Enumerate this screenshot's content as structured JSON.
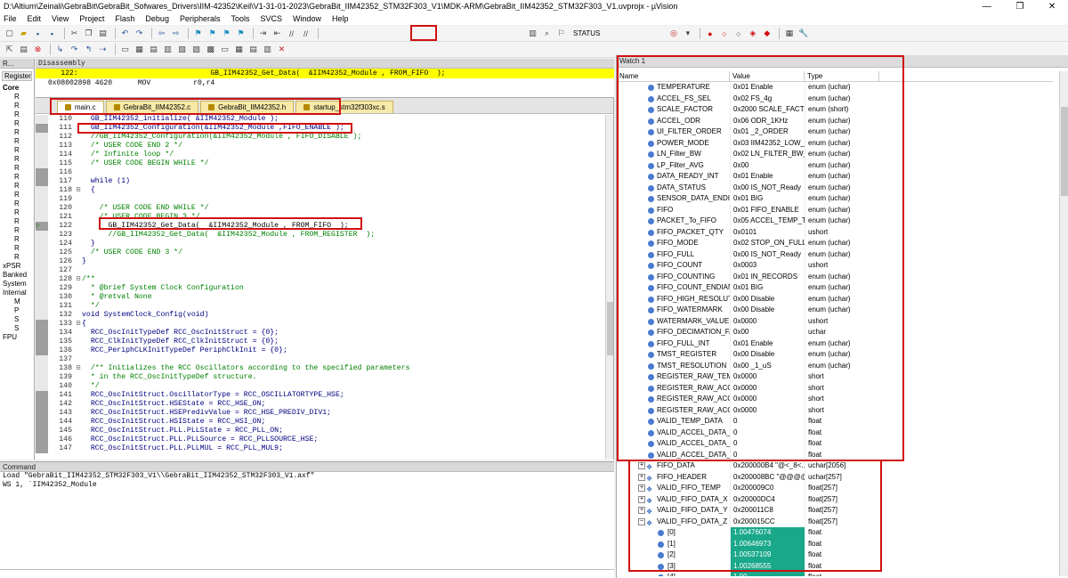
{
  "window": {
    "title": "D:\\Altium\\Zeinali\\GebraBit\\GebraBit_Sofwares_Drivers\\IIM-42352\\Keil\\V1-31-01-2023\\GebraBit_IIM42352_STM32F303_V1\\MDK-ARM\\GebraBit_IIM42352_STM32F303_V1.uvprojx - µVision"
  },
  "menu": [
    "File",
    "Edit",
    "View",
    "Project",
    "Flash",
    "Debug",
    "Peripherals",
    "Tools",
    "SVCS",
    "Window",
    "Help"
  ],
  "toolbar": {
    "target_label": "STATUS"
  },
  "left_pane": {
    "title": "R...",
    "tab": "Register",
    "tree": [
      "Core",
      "R",
      "R",
      "R",
      "R",
      "R",
      "R",
      "R",
      "R",
      "R",
      "R",
      "R",
      "R",
      "R",
      "R",
      "R",
      "R",
      "R",
      "R",
      "R",
      "xPSR",
      "Banked",
      "System",
      "Internal",
      "M",
      "P",
      "S",
      "S",
      "FPU"
    ]
  },
  "disassembly": {
    "title": "Disassembly",
    "line1": "   122:                               GB_IIM42352_Get_Data(  &IIM42352_Module , FROM_FIFO  );",
    "line2": "0x08002898 4620      MOV          r0,r4"
  },
  "editor": {
    "tabs": [
      "main.c",
      "GebraBit_IIM42352.c",
      "GebraBit_IIM42352.h",
      "startup_stm32f303xc.s"
    ],
    "lines": [
      {
        "n": "110",
        "t": "  GB_IIM42352_initialize( &IIM42352_Module );",
        "k": "code"
      },
      {
        "n": "111",
        "t": "  GB_IIM42352_Configuration(&IIM42352_Module ,FIFO_ENABLE );",
        "k": "code",
        "m": true
      },
      {
        "n": "112",
        "t": "  //GB_IIM42352_Configuration(&IIM42352_Module , FIFO_DISABLE );",
        "k": "cmt"
      },
      {
        "n": "113",
        "t": "  /* USER CODE END 2 */",
        "k": "cmt"
      },
      {
        "n": "114",
        "t": "  /* Infinite loop */",
        "k": "cmt"
      },
      {
        "n": "115",
        "t": "  /* USER CODE BEGIN WHILE */",
        "k": "cmt"
      },
      {
        "n": "116",
        "t": "",
        "k": "code",
        "m": true
      },
      {
        "n": "117",
        "t": "  while (1)",
        "k": "code",
        "m": true
      },
      {
        "n": "118",
        "t": "  {",
        "k": "code",
        "f": "⊟"
      },
      {
        "n": "119",
        "t": "",
        "k": "code"
      },
      {
        "n": "120",
        "t": "    /* USER CODE END WHILE */",
        "k": "cmt"
      },
      {
        "n": "121",
        "t": "    /* USER CODE BEGIN 3 */",
        "k": "cmt"
      },
      {
        "n": "122",
        "t": "      GB_IIM42352_Get_Data(  &IIM42352_Module , FROM_FIFO  );",
        "k": "cur",
        "m": true
      },
      {
        "n": "123",
        "t": "      //GB_IIM42352_Get_Data(  &IIM42352_Module , FROM_REGISTER  );",
        "k": "cmt"
      },
      {
        "n": "124",
        "t": "  }",
        "k": "code"
      },
      {
        "n": "125",
        "t": "  /* USER CODE END 3 */",
        "k": "cmt"
      },
      {
        "n": "126",
        "t": "}",
        "k": "code"
      },
      {
        "n": "127",
        "t": "",
        "k": "code"
      },
      {
        "n": "128",
        "t": "/**",
        "k": "cmt",
        "f": "⊟"
      },
      {
        "n": "129",
        "t": "  * @brief System Clock Configuration",
        "k": "cmt"
      },
      {
        "n": "130",
        "t": "  * @retval None",
        "k": "cmt"
      },
      {
        "n": "131",
        "t": "  */",
        "k": "cmt"
      },
      {
        "n": "132",
        "t": "void SystemClock_Config(void)",
        "k": "code"
      },
      {
        "n": "133",
        "t": "{",
        "k": "code",
        "m": true,
        "f": "⊟"
      },
      {
        "n": "134",
        "t": "  RCC_OscInitTypeDef RCC_OscInitStruct = {0};",
        "k": "code",
        "m": true
      },
      {
        "n": "135",
        "t": "  RCC_ClkInitTypeDef RCC_ClkInitStruct = {0};",
        "k": "code",
        "m": true
      },
      {
        "n": "136",
        "t": "  RCC_PeriphCLKInitTypeDef PeriphClkInit = {0};",
        "k": "code",
        "m": true
      },
      {
        "n": "137",
        "t": "",
        "k": "code"
      },
      {
        "n": "138",
        "t": "  /** Initializes the RCC Oscillators according to the specified parameters",
        "k": "cmt",
        "f": "⊟"
      },
      {
        "n": "139",
        "t": "  * in the RCC_OscInitTypeDef structure.",
        "k": "cmt"
      },
      {
        "n": "140",
        "t": "  */",
        "k": "cmt"
      },
      {
        "n": "141",
        "t": "  RCC_OscInitStruct.OscillatorType = RCC_OSCILLATORTYPE_HSE;",
        "k": "code",
        "m": true
      },
      {
        "n": "142",
        "t": "  RCC_OscInitStruct.HSEState = RCC_HSE_ON;",
        "k": "code",
        "m": true
      },
      {
        "n": "143",
        "t": "  RCC_OscInitStruct.HSEPredivValue = RCC_HSE_PREDIV_DIV1;",
        "k": "code",
        "m": true
      },
      {
        "n": "144",
        "t": "  RCC_OscInitStruct.HSIState = RCC_HSI_ON;",
        "k": "code",
        "m": true
      },
      {
        "n": "145",
        "t": "  RCC_OscInitStruct.PLL.PLLState = RCC_PLL_ON;",
        "k": "code",
        "m": true
      },
      {
        "n": "146",
        "t": "  RCC_OscInitStruct.PLL.PLLSource = RCC_PLLSOURCE_HSE;",
        "k": "code",
        "m": true
      },
      {
        "n": "147",
        "t": "  RCC_OscInitStruct.PLL.PLLMUL = RCC_PLL_MUL9;",
        "k": "code",
        "m": true
      }
    ]
  },
  "command": {
    "title": "Command",
    "lines": [
      "Load \"GebraBit_IIM42352_STM32F303_V1\\\\GebraBit_IIM42352_STM32F303_V1.axf\"",
      "WS 1, `IIM42352_Module"
    ]
  },
  "watch": {
    "title": "Watch 1",
    "columns": [
      "Name",
      "Value",
      "Type"
    ],
    "rows": [
      {
        "name": "TEMPERATURE",
        "value": "0x01 Enable",
        "type": "enum (uchar)"
      },
      {
        "name": "ACCEL_FS_SEL",
        "value": "0x02 FS_4g",
        "type": "enum (uchar)"
      },
      {
        "name": "SCALE_FACTOR",
        "value": "0x2000 SCALE_FACTO...",
        "type": "enum (short)"
      },
      {
        "name": "ACCEL_ODR",
        "value": "0x06 ODR_1KHz",
        "type": "enum (uchar)"
      },
      {
        "name": "UI_FILTER_ORDER",
        "value": "0x01 _2_ORDER",
        "type": "enum (uchar)"
      },
      {
        "name": "POWER_MODE",
        "value": "0x03 IIM42352_LOW_...",
        "type": "enum (uchar)"
      },
      {
        "name": "LN_Filter_BW",
        "value": "0x02 LN_FILTER_BW_5",
        "type": "enum (uchar)"
      },
      {
        "name": "LP_Filter_AVG",
        "value": "0x00",
        "type": "enum (uchar)"
      },
      {
        "name": "DATA_READY_INT",
        "value": "0x01 Enable",
        "type": "enum (uchar)"
      },
      {
        "name": "DATA_STATUS",
        "value": "0x00 IS_NOT_Ready",
        "type": "enum (uchar)"
      },
      {
        "name": "SENSOR_DATA_ENDIAN",
        "value": "0x01 BIG",
        "type": "enum (uchar)"
      },
      {
        "name": "FIFO",
        "value": "0x01 FIFO_ENABLE",
        "type": "enum (uchar)"
      },
      {
        "name": "PACKET_To_FIFO",
        "value": "0x05 ACCEL_TEMP_To...",
        "type": "enum (uchar)"
      },
      {
        "name": "FIFO_PACKET_QTY",
        "value": "0x0101",
        "type": "ushort"
      },
      {
        "name": "FIFO_MODE",
        "value": "0x02 STOP_ON_FULL",
        "type": "enum (uchar)"
      },
      {
        "name": "FIFO_FULL",
        "value": "0x00 IS_NOT_Ready",
        "type": "enum (uchar)"
      },
      {
        "name": "FIFO_COUNT",
        "value": "0x0003",
        "type": "ushort"
      },
      {
        "name": "FIFO_COUNTING",
        "value": "0x01 IN_RECORDS",
        "type": "enum (uchar)"
      },
      {
        "name": "FIFO_COUNT_ENDIAN",
        "value": "0x01 BIG",
        "type": "enum (uchar)"
      },
      {
        "name": "FIFO_HIGH_RESOLUTION",
        "value": "0x00 Disable",
        "type": "enum (uchar)"
      },
      {
        "name": "FIFO_WATERMARK",
        "value": "0x00 Disable",
        "type": "enum (uchar)"
      },
      {
        "name": "WATERMARK_VALUE",
        "value": "0x0000",
        "type": "ushort"
      },
      {
        "name": "FIFO_DECIMATION_FAC...",
        "value": "0x00",
        "type": "uchar"
      },
      {
        "name": "FIFO_FULL_INT",
        "value": "0x01 Enable",
        "type": "enum (uchar)"
      },
      {
        "name": "TMST_REGISTER",
        "value": "0x00 Disable",
        "type": "enum (uchar)"
      },
      {
        "name": "TMST_RESOLUTION",
        "value": "0x00 _1_uS",
        "type": "enum (uchar)"
      },
      {
        "name": "REGISTER_RAW_TEMP",
        "value": "0x0000",
        "type": "short"
      },
      {
        "name": "REGISTER_RAW_ACCEL_X",
        "value": "0x0000",
        "type": "short"
      },
      {
        "name": "REGISTER_RAW_ACCEL_Y",
        "value": "0x0000",
        "type": "short"
      },
      {
        "name": "REGISTER_RAW_ACCEL_Z",
        "value": "0x0000",
        "type": "short"
      },
      {
        "name": "VALID_TEMP_DATA",
        "value": "0",
        "type": "float"
      },
      {
        "name": "VALID_ACCEL_DATA_X",
        "value": "0",
        "type": "float"
      },
      {
        "name": "VALID_ACCEL_DATA_Y",
        "value": "0",
        "type": "float"
      },
      {
        "name": "VALID_ACCEL_DATA_Z",
        "value": "0",
        "type": "float"
      },
      {
        "name": "FIFO_DATA",
        "value": "0x200000B4 \"@<_8<...u...",
        "type": "uchar[2056]",
        "arr": "⊞"
      },
      {
        "name": "FIFO_HEADER",
        "value": "0x200008BC \"@@@@...",
        "type": "uchar[257]",
        "arr": "⊞"
      },
      {
        "name": "VALID_FIFO_TEMP",
        "value": "0x200009C0",
        "type": "float[257]",
        "arr": "⊞"
      },
      {
        "name": "VALID_FIFO_DATA_X",
        "value": "0x20000DC4",
        "type": "float[257]",
        "arr": "⊞"
      },
      {
        "name": "VALID_FIFO_DATA_Y",
        "value": "0x200011C8",
        "type": "float[257]",
        "arr": "⊞"
      },
      {
        "name": "VALID_FIFO_DATA_Z",
        "value": "0x200015CC",
        "type": "float[257]",
        "arr": "⊟"
      },
      {
        "name": "[0]",
        "value": "1.00476074",
        "type": "float",
        "child": true
      },
      {
        "name": "[1]",
        "value": "1.00646973",
        "type": "float",
        "child": true
      },
      {
        "name": "[2]",
        "value": "1.00537109",
        "type": "float",
        "child": true
      },
      {
        "name": "[3]",
        "value": "1.00268555",
        "type": "float",
        "child": true
      },
      {
        "name": "[4]",
        "value": "1.00...",
        "type": "float",
        "child": true
      }
    ]
  }
}
